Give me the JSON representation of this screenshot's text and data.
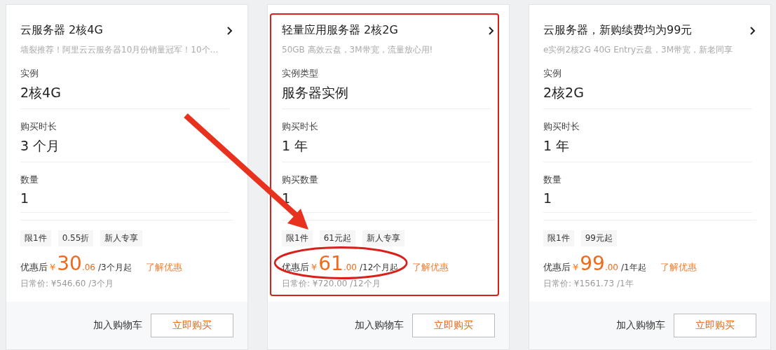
{
  "cards": [
    {
      "title": "云服务器 2核4G",
      "subtitle": "墙裂推荐！阿里云云服务器10月份销量冠军！10个…",
      "highlighted": false,
      "price_circled": false,
      "fields": [
        {
          "label": "实例",
          "value": "2核4G"
        },
        {
          "label": "购买时长",
          "value": "3 个月"
        },
        {
          "label": "数量",
          "value": "1"
        }
      ],
      "tags": [
        "限1件",
        "0.55折",
        "新人专享"
      ],
      "price": {
        "prefix": "优惠后",
        "currency": "¥",
        "integer": "30",
        "decimal": ".06",
        "unit": "/3个月起"
      },
      "link": "了解优惠",
      "regular": "日常价: ¥546.60 /3个月",
      "cart_button": "加入购物车",
      "buy_button": "立即购买"
    },
    {
      "title": "轻量应用服务器 2核2G",
      "subtitle": "50GB 高效云盘，3M带宽，流量放心用!",
      "highlighted": true,
      "price_circled": true,
      "fields": [
        {
          "label": "实例类型",
          "value": "服务器实例"
        },
        {
          "label": "购买时长",
          "value": "1 年"
        },
        {
          "label": "购买数量",
          "value": "1"
        }
      ],
      "tags": [
        "限1件",
        "61元起",
        "新人专享"
      ],
      "price": {
        "prefix": "优惠后",
        "currency": "¥",
        "integer": "61",
        "decimal": ".00",
        "unit": "/12个月起"
      },
      "link": "了解优惠",
      "regular": "日常价: ¥720.00 /12个月",
      "cart_button": "加入购物车",
      "buy_button": "立即购买"
    },
    {
      "title": "云服务器，新购续费均为99元",
      "subtitle": "e实例2核2G 40G Entry云盘，3M带宽，新老同享",
      "highlighted": false,
      "price_circled": false,
      "fields": [
        {
          "label": "实例",
          "value": "2核2G"
        },
        {
          "label": "购买时长",
          "value": "1 年"
        },
        {
          "label": "数量",
          "value": "1"
        }
      ],
      "tags": [
        "限1件",
        "99元起"
      ],
      "price": {
        "prefix": "优惠后",
        "currency": "¥",
        "integer": "99",
        "decimal": ".00",
        "unit": "/1年起"
      },
      "link": "了解优惠",
      "regular": "日常价: ¥1561.73 /1年",
      "cart_button": "加入购物车",
      "buy_button": "立即购买"
    }
  ]
}
